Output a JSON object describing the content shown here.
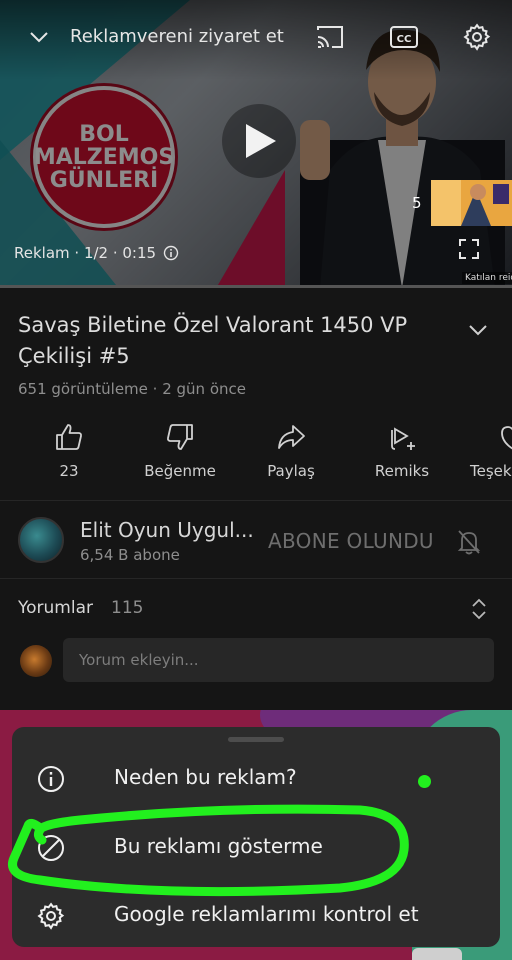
{
  "player": {
    "title": "Reklamvereni ziyaret et",
    "promo_lines": [
      "BOL",
      "MALZEMOS",
      "GÜNLERİ"
    ],
    "ad_label": "Reklam · 1/2 · 0:15",
    "skip_count": "5",
    "thumb_caption": "Katılan reid",
    "progress_fraction": 0
  },
  "video": {
    "title": "Savaş Biletine Özel Valorant 1450 VP Çekilişi #5",
    "meta": "651 görüntüleme · 2 gün önce"
  },
  "actions": [
    {
      "label": "23",
      "icon": "thumbs-up-icon"
    },
    {
      "label": "Beğenme",
      "icon": "thumbs-down-icon"
    },
    {
      "label": "Paylaş",
      "icon": "share-icon"
    },
    {
      "label": "Remiks",
      "icon": "remix-icon"
    },
    {
      "label": "Teşek",
      "icon": "thanks-icon"
    }
  ],
  "channel": {
    "name": "Elit Oyun Uygul...",
    "subscribers": "6,54 B abone",
    "subscribed_label": "ABONE OLUNDU"
  },
  "comments": {
    "title": "Yorumlar",
    "count": "115",
    "placeholder": "Yorum ekleyin..."
  },
  "sheet": {
    "items": [
      {
        "label": "Neden bu reklam?",
        "icon": "info-icon"
      },
      {
        "label": "Bu reklamı gösterme",
        "icon": "block-icon"
      },
      {
        "label": "Google reklamlarımı kontrol et",
        "icon": "gear-icon"
      }
    ]
  },
  "colors": {
    "annotation": "#22f01e",
    "background": "#181818",
    "sheet": "#2c2c2c"
  }
}
